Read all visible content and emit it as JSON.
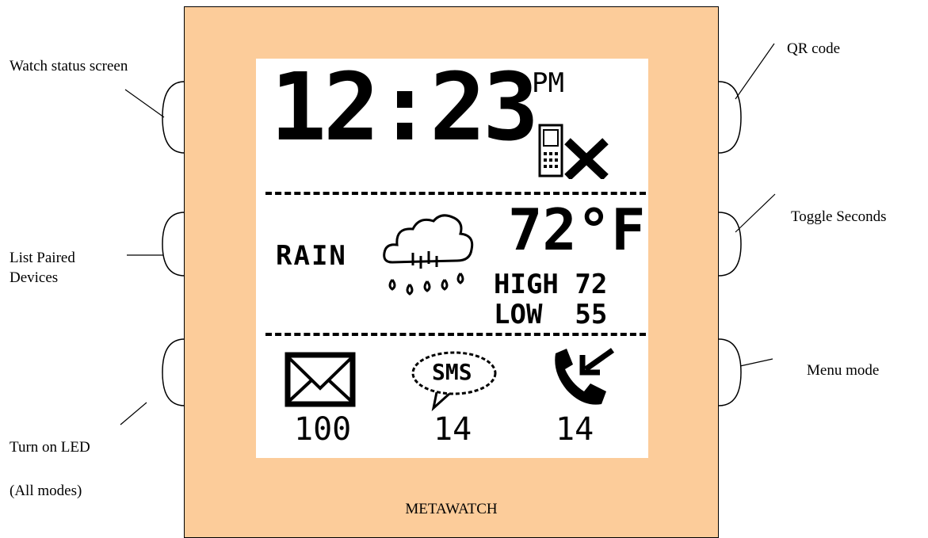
{
  "labels": {
    "watch_status": "Watch status screen",
    "list_paired": "List Paired Devices",
    "turn_on_led": "Turn on LED",
    "all_modes": "(All modes)",
    "qr_code": "QR code",
    "toggle_seconds": "Toggle Seconds",
    "menu_mode": "Menu mode"
  },
  "watch": {
    "brand": "METAWATCH",
    "body_color": "#fccc9a"
  },
  "screen": {
    "time": "12:23",
    "ampm": "PM",
    "weather": "RAIN",
    "temperature": "72°F",
    "high": "HIGH 72",
    "low": "LOW  55",
    "email_count": "100",
    "sms_label": "SMS",
    "sms_count": "14",
    "call_count": "14"
  },
  "icons": [
    "phone-disconnected-icon",
    "rain-cloud-icon",
    "envelope-icon",
    "sms-bubble-icon",
    "missed-call-icon"
  ]
}
